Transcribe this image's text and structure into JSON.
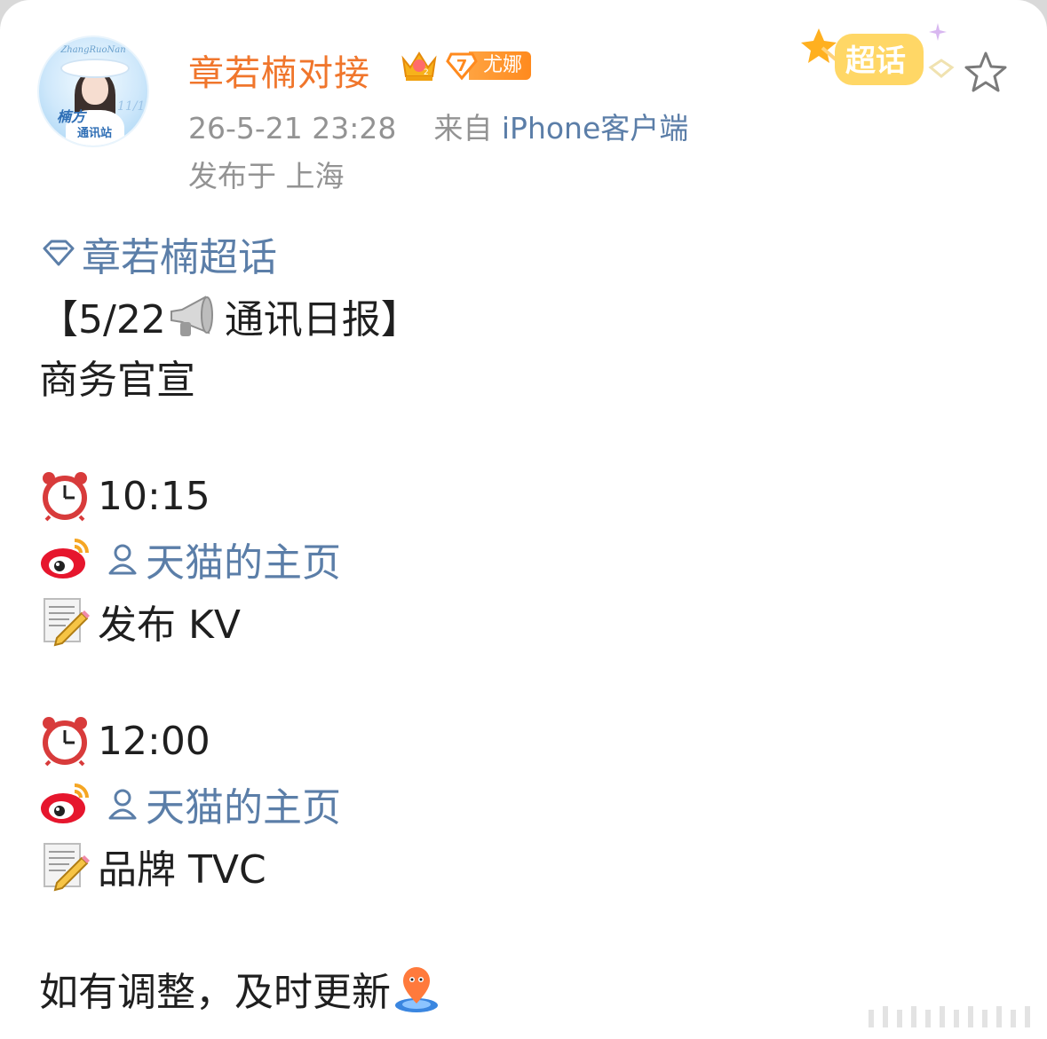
{
  "post": {
    "author": "章若楠对接",
    "level": "7",
    "level_tag": "尤娜",
    "timestamp": "26-5-21 23:28",
    "source_prefix": "来自",
    "source_client": "iPhone客户端",
    "location": "发布于 上海",
    "supertopic_label": "超话",
    "avatar_text_top": "ZhangRuoNan",
    "avatar_text_badge": "楠方",
    "avatar_text_sub": "通讯站"
  },
  "content": {
    "topic_link": "章若楠超话",
    "title_open": "【5/22",
    "title_close": "通讯日报】",
    "category": "商务官宣",
    "entries": [
      {
        "time": "10:15",
        "account": "天猫的主页",
        "task": "发布 KV"
      },
      {
        "time": "12:00",
        "account": "天猫的主页",
        "task": "品牌 TVC"
      }
    ],
    "footer": "如有调整，及时更新"
  },
  "colors": {
    "username": "#f0762c",
    "link": "#5b7ea8",
    "meta": "#939393",
    "text": "#1f1f1f"
  },
  "icons": {
    "crown": "crown-icon",
    "level": "level-badge-icon",
    "supertopic": "supertopic-badge-icon",
    "favorite": "star-icon",
    "diamond": "diamond-icon",
    "megaphone": "megaphone-icon",
    "alarm": "alarm-clock-icon",
    "weibo": "weibo-logo-icon",
    "user": "user-icon",
    "memo": "memo-icon",
    "location_pin": "location-pin-icon"
  }
}
